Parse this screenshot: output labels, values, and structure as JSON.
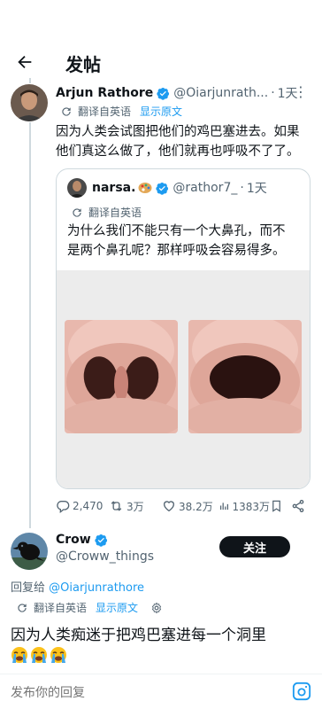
{
  "header": {
    "title": "发帖"
  },
  "original": {
    "name": "Arjun Rathore",
    "handle": "@Oiarjunrath...",
    "time": "1天",
    "translate_label": "翻译自英语",
    "show_original": "显示原文",
    "text_line1": "因为人类会试图把他们的鸡巴塞进去。如果",
    "text_line2": "他们真这么做了，他们就再也呼吸不了了。"
  },
  "quote": {
    "name": "narsa.",
    "handle": "@rathor7_",
    "time": "1天",
    "translate_label": "翻译自英语",
    "text_line1": "为什么我们不能只有一个大鼻孔，而不",
    "text_line2": "是两个鼻孔呢？那样呼吸会容易得多。"
  },
  "stats": {
    "replies": "2,470",
    "retweets": "3万",
    "likes": "38.2万",
    "views": "1383万"
  },
  "reply": {
    "name": "Crow",
    "handle": "@Croww_things",
    "follow_label": "关注",
    "reply_to_prefix": "回复给",
    "reply_to_handle": "@Oiarjunrathore",
    "translate_label": "翻译自英语",
    "show_original": "显示原文",
    "text": "因为人类痴迷于把鸡巴塞进每一个洞里",
    "emoji_count": 3
  },
  "compose": {
    "placeholder": "发布你的回复"
  },
  "colors": {
    "accent": "#1d9bf0",
    "text": "#0f1419",
    "muted": "#536471",
    "border": "#cfd9de"
  }
}
